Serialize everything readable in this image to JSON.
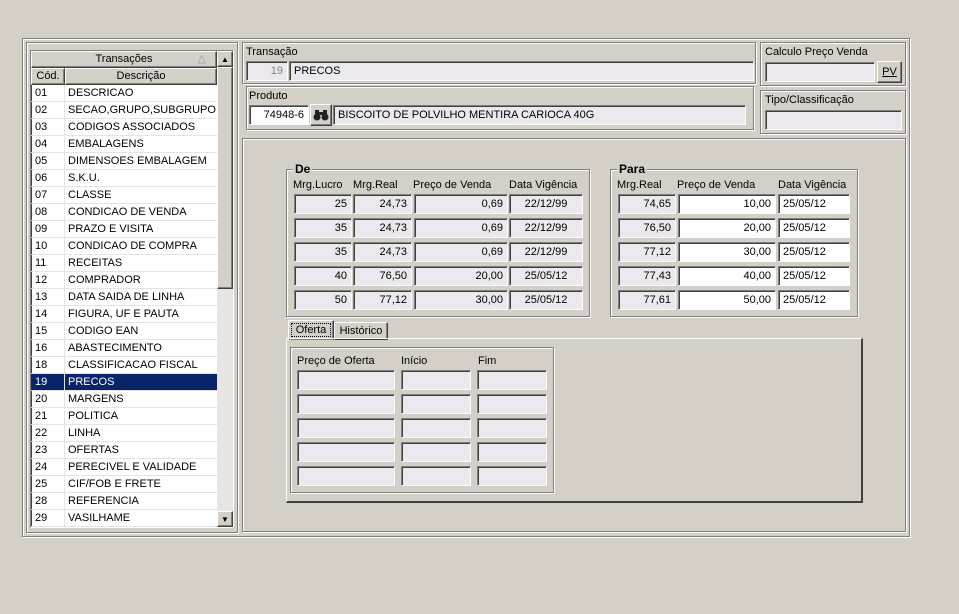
{
  "transacoes": {
    "title": "Transações",
    "col_cod": "Cód.",
    "col_desc": "Descrição",
    "sort_icon": "sort-up-icon",
    "items": [
      {
        "cod": "01",
        "desc": "DESCRICAO"
      },
      {
        "cod": "02",
        "desc": "SECAO,GRUPO,SUBGRUPO"
      },
      {
        "cod": "03",
        "desc": "CODIGOS ASSOCIADOS"
      },
      {
        "cod": "04",
        "desc": "EMBALAGENS"
      },
      {
        "cod": "05",
        "desc": "DIMENSOES EMBALAGEM"
      },
      {
        "cod": "06",
        "desc": "S.K.U."
      },
      {
        "cod": "07",
        "desc": "CLASSE"
      },
      {
        "cod": "08",
        "desc": "CONDICAO DE VENDA"
      },
      {
        "cod": "09",
        "desc": "PRAZO E VISITA"
      },
      {
        "cod": "10",
        "desc": "CONDICAO DE COMPRA"
      },
      {
        "cod": "11",
        "desc": "RECEITAS"
      },
      {
        "cod": "12",
        "desc": "COMPRADOR"
      },
      {
        "cod": "13",
        "desc": "DATA SAIDA DE LINHA"
      },
      {
        "cod": "14",
        "desc": "FIGURA, UF E PAUTA"
      },
      {
        "cod": "15",
        "desc": "CODIGO EAN"
      },
      {
        "cod": "16",
        "desc": "ABASTECIMENTO"
      },
      {
        "cod": "18",
        "desc": "CLASSIFICACAO FISCAL"
      },
      {
        "cod": "19",
        "desc": "PRECOS",
        "selected": true
      },
      {
        "cod": "20",
        "desc": "MARGENS"
      },
      {
        "cod": "21",
        "desc": "POLITICA"
      },
      {
        "cod": "22",
        "desc": "LINHA"
      },
      {
        "cod": "23",
        "desc": "OFERTAS"
      },
      {
        "cod": "24",
        "desc": "PERECIVEL E VALIDADE"
      },
      {
        "cod": "25",
        "desc": "CIF/FOB E FRETE"
      },
      {
        "cod": "28",
        "desc": "REFERENCIA"
      },
      {
        "cod": "29",
        "desc": "VASILHAME"
      }
    ]
  },
  "transacao": {
    "label": "Transação",
    "code": "19",
    "name": "PRECOS"
  },
  "produto": {
    "label": "Produto",
    "code": "74948-6",
    "lookup_icon": "binoculars-icon",
    "name": "BISCOITO DE POLVILHO MENTIRA CARIOCA 40G"
  },
  "calculo": {
    "label": "Calculo Preço Venda",
    "value": "",
    "button": "PV"
  },
  "tipo": {
    "label": "Tipo/Classificação",
    "value": ""
  },
  "de": {
    "title": "De",
    "headers": [
      "Mrg.Lucro",
      "Mrg.Real",
      "Preço de Venda",
      "Data Vigência"
    ],
    "rows": [
      [
        "25",
        "24,73",
        "0,69",
        "22/12/99"
      ],
      [
        "35",
        "24,73",
        "0,69",
        "22/12/99"
      ],
      [
        "35",
        "24,73",
        "0,69",
        "22/12/99"
      ],
      [
        "40",
        "76,50",
        "20,00",
        "25/05/12"
      ],
      [
        "50",
        "77,12",
        "30,00",
        "25/05/12"
      ]
    ]
  },
  "para": {
    "title": "Para",
    "headers": [
      "Mrg.Real",
      "Preço de Venda",
      "Data Vigência"
    ],
    "rows": [
      [
        "74,65",
        "10,00",
        "25/05/12"
      ],
      [
        "76,50",
        "20,00",
        "25/05/12"
      ],
      [
        "77,12",
        "30,00",
        "25/05/12"
      ],
      [
        "77,43",
        "40,00",
        "25/05/12"
      ],
      [
        "77,61",
        "50,00",
        "25/05/12"
      ]
    ]
  },
  "tabs": [
    {
      "label": "Oferta",
      "active": true
    },
    {
      "label": "Histórico",
      "active": false
    }
  ],
  "oferta": {
    "headers": [
      "Preço de Oferta",
      "Início",
      "Fim"
    ],
    "rows": [
      [
        "",
        "",
        ""
      ],
      [
        "",
        "",
        ""
      ],
      [
        "",
        "",
        ""
      ],
      [
        "",
        "",
        ""
      ],
      [
        "",
        "",
        ""
      ]
    ]
  }
}
